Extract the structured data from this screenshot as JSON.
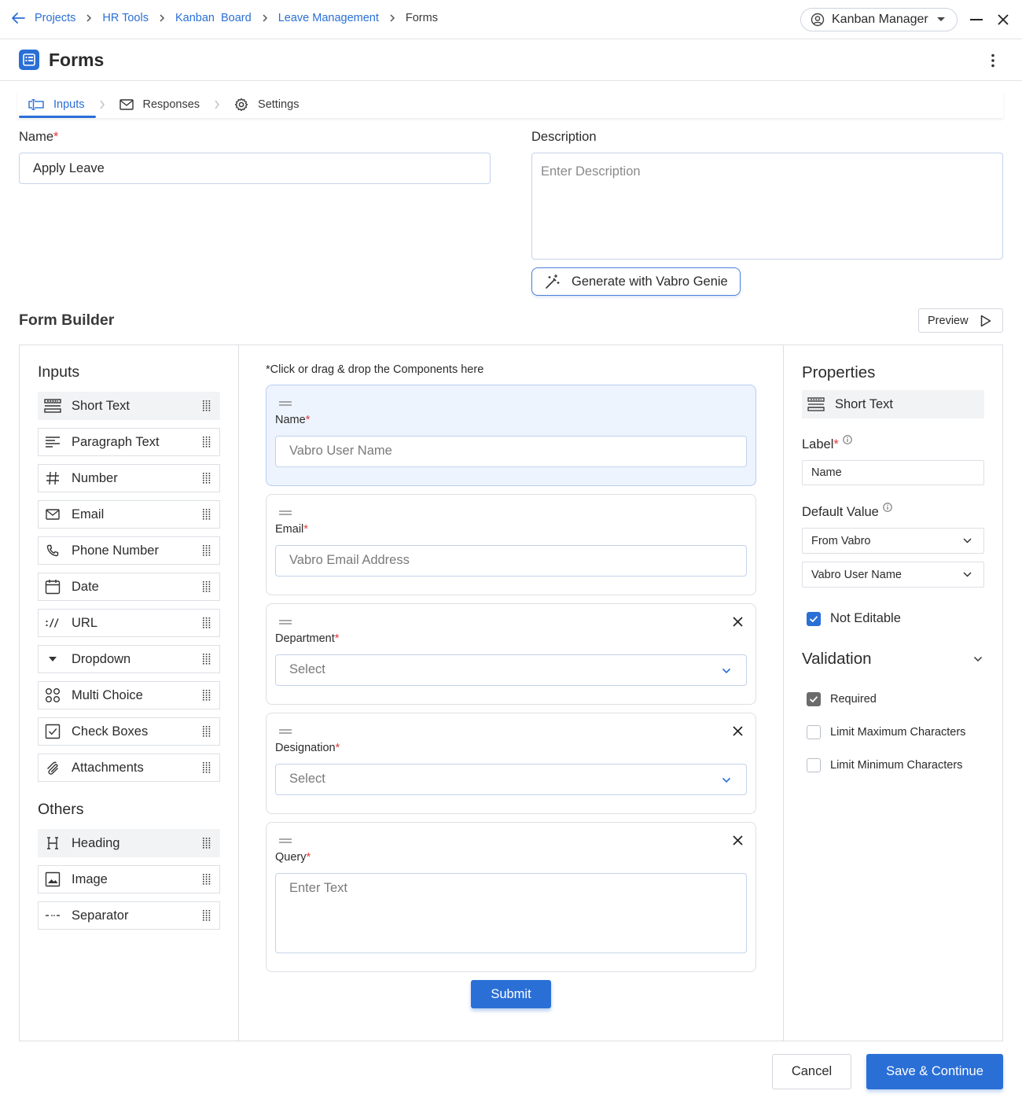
{
  "breadcrumb": {
    "items": [
      "Projects",
      "HR Tools",
      "Kanban  Board",
      "Leave Management"
    ],
    "current": "Forms"
  },
  "user": {
    "name": "Kanban Manager"
  },
  "page": {
    "title": "Forms"
  },
  "tabs": [
    {
      "label": "Inputs",
      "icon": "input-icon",
      "active": true
    },
    {
      "label": "Responses",
      "icon": "mail-icon",
      "active": false
    },
    {
      "label": "Settings",
      "icon": "gear-icon",
      "active": false
    }
  ],
  "form": {
    "name_label": "Name",
    "name_value": "Apply Leave",
    "description_label": "Description",
    "description_placeholder": "Enter Description",
    "genie_button": "Generate with Vabro Genie"
  },
  "builder": {
    "title": "Form Builder",
    "preview_button": "Preview",
    "inputs_heading": "Inputs",
    "inputs": [
      {
        "label": "Short Text",
        "icon": "short-text-icon"
      },
      {
        "label": "Paragraph Text",
        "icon": "paragraph-icon"
      },
      {
        "label": "Number",
        "icon": "hash-icon"
      },
      {
        "label": "Email",
        "icon": "mail-icon"
      },
      {
        "label": "Phone Number",
        "icon": "phone-icon"
      },
      {
        "label": "Date",
        "icon": "calendar-icon"
      },
      {
        "label": "URL",
        "icon": "url-icon"
      },
      {
        "label": "Dropdown",
        "icon": "dropdown-icon"
      },
      {
        "label": "Multi Choice",
        "icon": "multi-choice-icon"
      },
      {
        "label": "Check Boxes",
        "icon": "checkbox-icon"
      },
      {
        "label": "Attachments",
        "icon": "paperclip-icon"
      }
    ],
    "others_heading": "Others",
    "others": [
      {
        "label": "Heading",
        "icon": "heading-icon"
      },
      {
        "label": "Image",
        "icon": "image-icon"
      },
      {
        "label": "Separator",
        "icon": "separator-icon"
      }
    ],
    "canvas_hint": "*Click or drag & drop the Components here",
    "fields": [
      {
        "label": "Name",
        "placeholder": "Vabro User Name",
        "type": "text"
      },
      {
        "label": "Email",
        "placeholder": "Vabro Email Address",
        "type": "text"
      },
      {
        "label": "Department",
        "placeholder": "Select",
        "type": "select"
      },
      {
        "label": "Designation",
        "placeholder": "Select",
        "type": "select"
      },
      {
        "label": "Query",
        "placeholder": "Enter Text",
        "type": "textarea"
      }
    ],
    "submit_button": "Submit"
  },
  "properties": {
    "heading": "Properties",
    "component": "Short Text",
    "label_label": "Label",
    "label_value": "Name",
    "default_label": "Default Value",
    "default_source": "From Vabro",
    "default_field": "Vabro User Name",
    "not_editable": "Not Editable",
    "validation_heading": "Validation",
    "validations": [
      "Required",
      "Limit Maximum Characters",
      "Limit Minimum Characters"
    ]
  },
  "footer": {
    "cancel": "Cancel",
    "save": "Save & Continue"
  },
  "colors": {
    "accent": "#2a6fd6",
    "required": "#e0393e",
    "border": "#dcdfe4"
  }
}
